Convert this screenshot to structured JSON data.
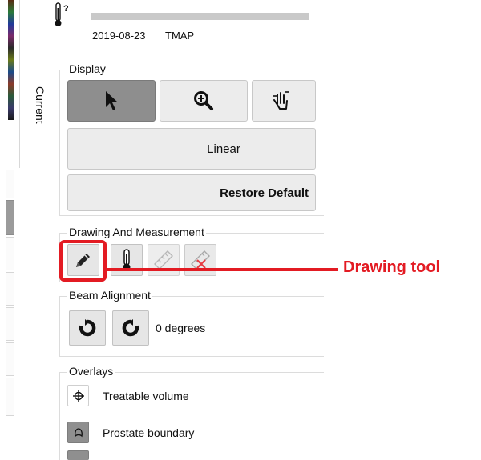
{
  "header": {
    "date": "2019-08-23",
    "map": "TMAP",
    "gauge_icon": "thermometer-question-icon"
  },
  "sidebar": {
    "vertical_tab_label": "Current"
  },
  "display": {
    "label": "Display",
    "tools": [
      {
        "name": "pointer-icon",
        "selected": true
      },
      {
        "name": "zoom-in-icon",
        "selected": false
      },
      {
        "name": "pan-hand-icon",
        "selected": false
      }
    ],
    "scale_button": "Linear",
    "restore_button": "Restore Default"
  },
  "drawing": {
    "label": "Drawing And Measurement",
    "tools": [
      "pencil-icon",
      "thermometer-icon",
      "ruler-icon",
      "ruler-delete-icon"
    ]
  },
  "beam": {
    "label": "Beam Alignment",
    "rotate_cw_icon": "rotate-clockwise-icon",
    "rotate_ccw_icon": "rotate-counterclockwise-icon",
    "degrees_text": "0 degrees"
  },
  "overlays": {
    "label": "Overlays",
    "items": [
      {
        "label": "Treatable volume",
        "icon": "crosshair-icon"
      },
      {
        "label": "Prostate boundary",
        "icon": "outline-icon"
      }
    ]
  },
  "annotation": {
    "text": "Drawing tool",
    "color": "#e31b23"
  }
}
